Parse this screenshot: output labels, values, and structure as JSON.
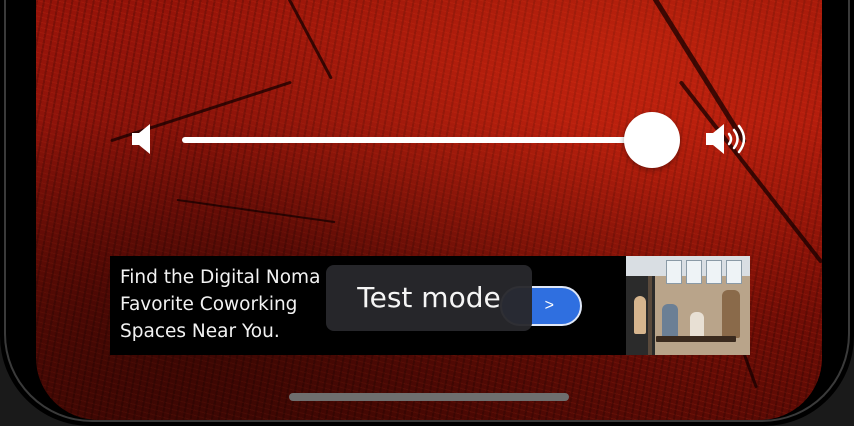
{
  "volume": {
    "level_fraction": 0.98,
    "mute_icon": "speaker-low-icon",
    "max_icon": "speaker-high-icon"
  },
  "ad": {
    "text": "Find the Digital Noma\nFavorite Coworking\nSpaces Near You.",
    "cta_label": ">"
  },
  "toast": {
    "label": "Test mode"
  },
  "colors": {
    "background": "#9c150a",
    "accent": "#2f6fe0",
    "toast": "#28282c"
  }
}
